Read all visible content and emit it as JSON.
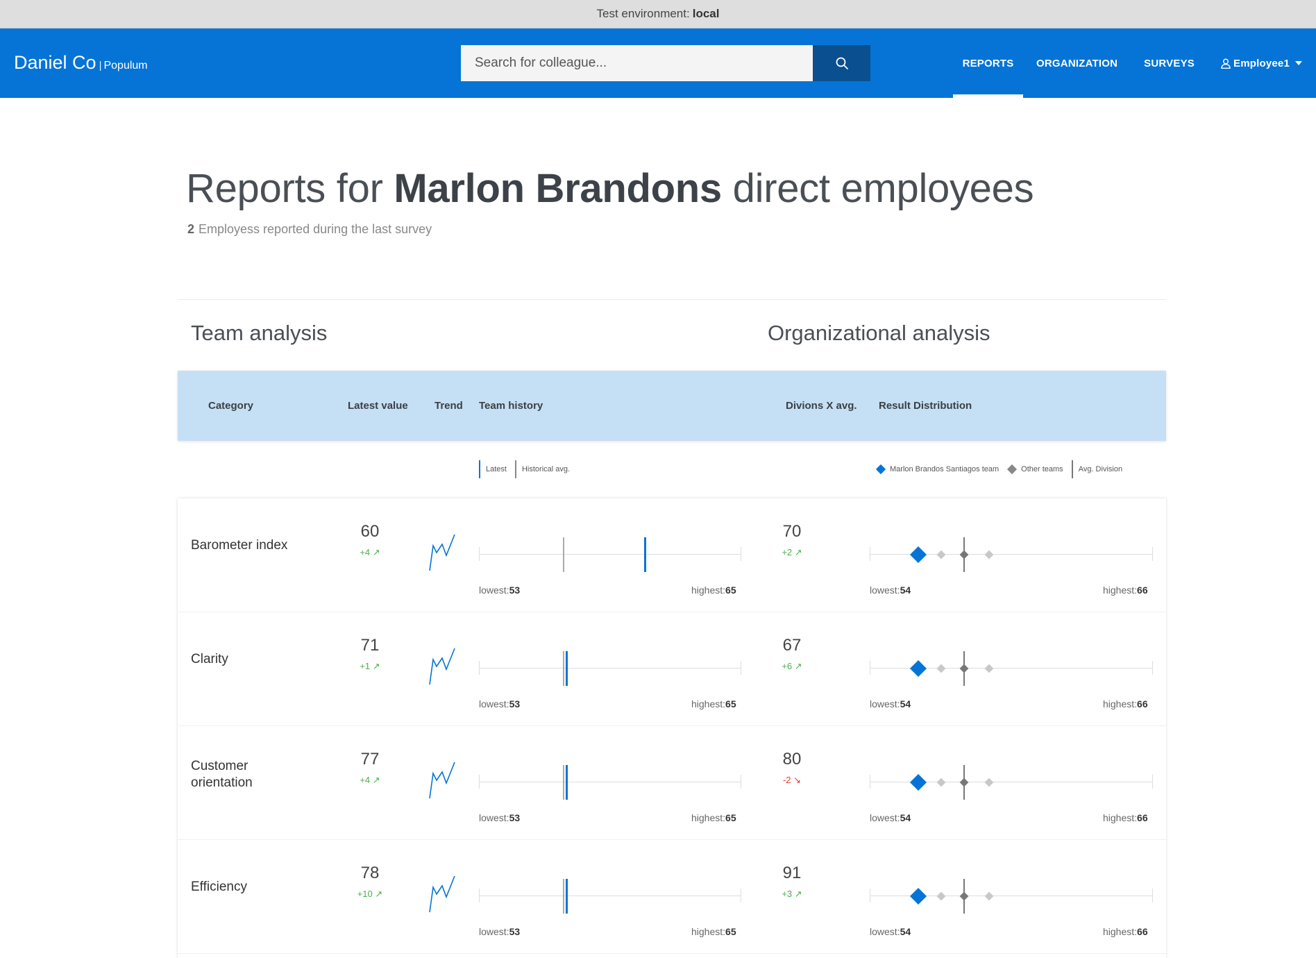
{
  "env": {
    "label": "Test environment:",
    "value": "local"
  },
  "brand": {
    "name": "Daniel Co",
    "separator": "|",
    "product": "Populum"
  },
  "search": {
    "placeholder": "Search for colleague..."
  },
  "nav": {
    "reports": "REPORTS",
    "organization": "ORGANIZATION",
    "surveys": "SURVEYS",
    "user": "Employee1"
  },
  "page": {
    "title_pre": "Reports for",
    "title_name": "Marlon Brandons",
    "title_post": "direct employees",
    "count": "2",
    "subtitle": "Employess reported during the last survey"
  },
  "sections": {
    "team": "Team analysis",
    "org": "Organizational analysis"
  },
  "headers": {
    "category": "Category",
    "latest": "Latest value",
    "trend": "Trend",
    "history": "Team history",
    "division_avg": "Divions X avg.",
    "distribution": "Result Distribution"
  },
  "legend_team": {
    "latest": "Latest",
    "historical": "Historical avg."
  },
  "legend_org": {
    "team": "Marlon Brandos Santiagos team",
    "other": "Other teams",
    "avg": "Avg. Division"
  },
  "range_labels": {
    "lowest": "lowest:",
    "highest": "highest:"
  },
  "rows": [
    {
      "category": "Barometer index",
      "latest": "60",
      "latest_delta": "+4 ↗",
      "latest_dir": "up",
      "team_lowest": "53",
      "team_highest": "65",
      "team_hist_pos": 0.32,
      "team_latest_pos": 0.63,
      "division": "70",
      "division_delta": "+2 ↗",
      "division_dir": "up",
      "org_lowest": "54",
      "org_highest": "66"
    },
    {
      "category": "Clarity",
      "latest": "71",
      "latest_delta": "+1 ↗",
      "latest_dir": "up",
      "team_lowest": "53",
      "team_highest": "65",
      "team_hist_pos": 0.32,
      "team_latest_pos": 0.33,
      "division": "67",
      "division_delta": "+6 ↗",
      "division_dir": "up",
      "org_lowest": "54",
      "org_highest": "66"
    },
    {
      "category": "Customer orientation",
      "latest": "77",
      "latest_delta": "+4 ↗",
      "latest_dir": "up",
      "team_lowest": "53",
      "team_highest": "65",
      "team_hist_pos": 0.32,
      "team_latest_pos": 0.33,
      "division": "80",
      "division_delta": "-2 ↘",
      "division_dir": "down",
      "org_lowest": "54",
      "org_highest": "66"
    },
    {
      "category": "Efficiency",
      "latest": "78",
      "latest_delta": "+10 ↗",
      "latest_dir": "up",
      "team_lowest": "53",
      "team_highest": "65",
      "team_hist_pos": 0.32,
      "team_latest_pos": 0.33,
      "division": "91",
      "division_delta": "+3 ↗",
      "division_dir": "up",
      "org_lowest": "54",
      "org_highest": "66"
    }
  ],
  "colors": {
    "primary": "#0574d6",
    "header_bg": "#c5dff5",
    "positive": "#4caf50",
    "negative": "#e53935"
  },
  "icons": {
    "search": "search-icon",
    "user": "user-icon",
    "caret": "caret-down-icon"
  }
}
